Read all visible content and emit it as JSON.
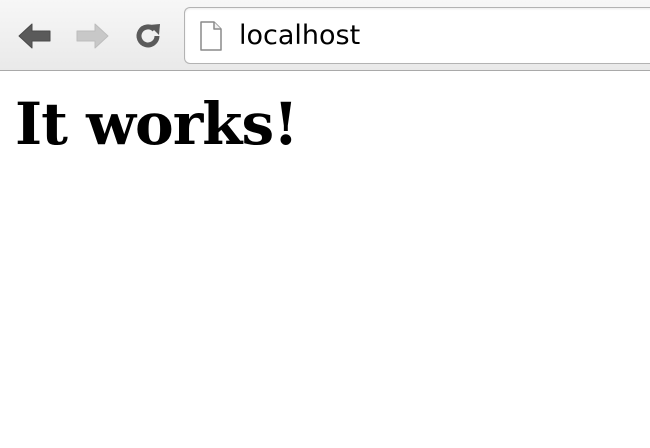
{
  "toolbar": {
    "buttons": [
      {
        "name": "back",
        "icon": "arrow-left-icon",
        "enabled": true
      },
      {
        "name": "forward",
        "icon": "arrow-right-icon",
        "enabled": false
      },
      {
        "name": "reload",
        "icon": "reload-icon",
        "enabled": true
      }
    ],
    "address_bar": {
      "icon": "page-icon",
      "url": "localhost"
    }
  },
  "page": {
    "heading": "It works!"
  },
  "colors": {
    "icon_enabled": "#5a5a5a",
    "icon_disabled": "#c4c4c4",
    "toolbar_bg": "#ececec",
    "page_bg": "#ffffff"
  }
}
